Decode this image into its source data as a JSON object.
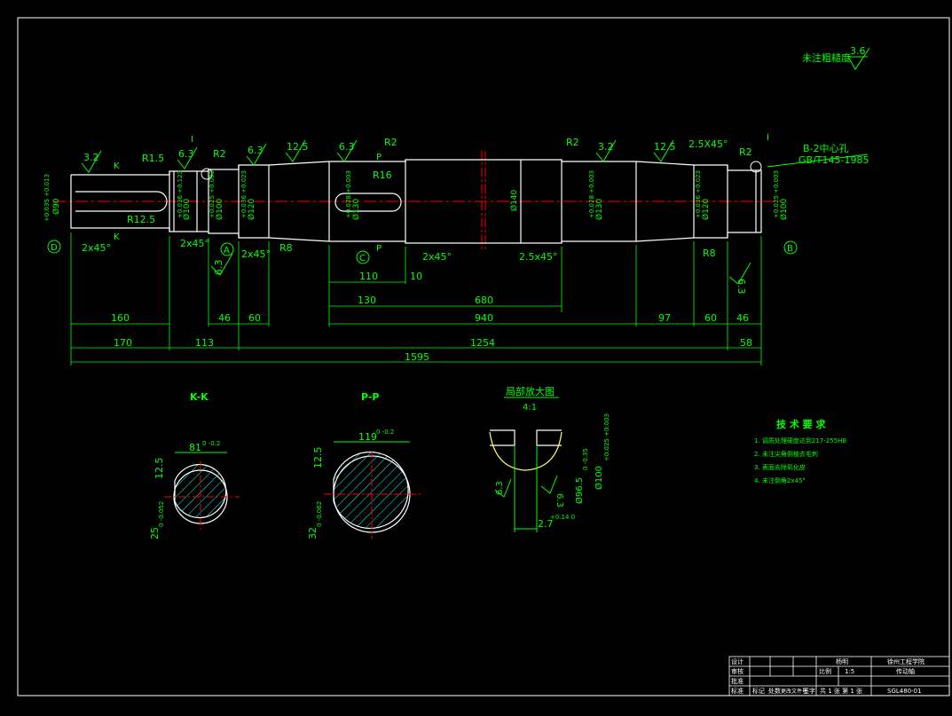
{
  "colors": {
    "background": "#000000",
    "outline": "#ffffff",
    "dimension": "#00ff00",
    "centerline": "#ff0000",
    "hatch": "#00ffff",
    "groove": "#ffff66",
    "note": "#00ff00"
  },
  "roughness_note": {
    "label": "未注粗糙度",
    "value": "3.6"
  },
  "center_hole": {
    "line1": "B-2中心孔",
    "line2": "GB/T145-1985"
  },
  "labels": {
    "datum_d": "D",
    "datum_a": "A",
    "datum_c": "C",
    "datum_b": "B",
    "section_k_top": "K",
    "section_k_bottom": "K",
    "section_p_top": "P",
    "section_p_bottom": "P",
    "detail_i_left": "I",
    "detail_i_right": "I"
  },
  "roughness_marks": [
    {
      "id": "r1",
      "value": "3.2"
    },
    {
      "id": "r2",
      "value": "6.3"
    },
    {
      "id": "r3",
      "value": "6.3"
    },
    {
      "id": "r4",
      "value": "12.5"
    },
    {
      "id": "r5",
      "value": "6.3"
    },
    {
      "id": "r6",
      "value": "3.2"
    },
    {
      "id": "r7",
      "value": "12.5"
    },
    {
      "id": "r8",
      "value": "6.3"
    },
    {
      "id": "r9",
      "value": "6.3"
    }
  ],
  "radii": {
    "r15": "R1.5",
    "r2a": "R2",
    "r2b": "R2",
    "r2c": "R2",
    "r2d": "R2",
    "r125": "R12.5",
    "r16": "R16",
    "r8a": "R8",
    "r8b": "R8"
  },
  "chamfers": {
    "c1": "2x45°",
    "c2": "2x45°",
    "c3": "2x45°",
    "c4": "2x45°",
    "c5": "2.5x45°",
    "c6": "2.5X45°"
  },
  "diameters": {
    "d90": "Ø90",
    "d90_tol": "+0.035 +0.013",
    "d100a": "Ø100",
    "d100a_tol": "+0.036 +0.123",
    "d100b": "Ø100",
    "d100b_tol": "+0.025 +0.003",
    "d120a": "Ø120",
    "d120a_tol": "+0.036 +0.023",
    "d130a": "Ø130",
    "d130a_tol": "+0.028 +0.003",
    "d140": "Ø140",
    "d130b": "Ø130",
    "d130b_tol": "+0.028 +0.003",
    "d120b": "Ø120",
    "d120b_tol": "+0.036 +0.023",
    "d100c": "Ø100",
    "d100c_tol": "+0.025 +0.003"
  },
  "dims": {
    "d160": "160",
    "d46a": "46",
    "d60a": "60",
    "d110": "110",
    "d10": "10",
    "d130": "130",
    "d680": "680",
    "d940": "940",
    "d97": "97",
    "d60b": "60",
    "d46b": "46",
    "d170": "170",
    "d113": "113",
    "d1254": "1254",
    "d58": "58",
    "d1595": "1595"
  },
  "section_k": {
    "title": "K-K",
    "width": "81",
    "width_tol": "0 -0.2",
    "key": "25",
    "key_tol": "0 -0.052",
    "rough": "12.5"
  },
  "section_p": {
    "title": "P-P",
    "width": "119",
    "width_tol": "0 -0.2",
    "key": "32",
    "key_tol": "0 -0.062",
    "rough": "12.5"
  },
  "detail": {
    "title": "局部放大图",
    "scale": "4:1",
    "d96": "Ø96.5",
    "d96_tol": "0 -0.35",
    "d100": "Ø100",
    "d100_tol": "+0.025 +0.003",
    "groove": "2.7",
    "groove_tol": "+0.14 0",
    "rough1": "6.3",
    "rough2": "6.3"
  },
  "tech": {
    "title": "技 术 要 求",
    "items": [
      "1. 调质处理硬度达到217-255HB",
      "2. 未注尖角倒棱去毛刺",
      "3. 表面去除氧化皮",
      "4. 未注倒角2x45°"
    ]
  },
  "title_block": {
    "designer": "设计",
    "checker": "审核",
    "approver": "批准",
    "standard": "标准",
    "name_col": "杨明",
    "scale_label": "比例",
    "scale_value": "1:5",
    "sheet": "共 1 张  第 1 张",
    "school": "徐州工程学院",
    "part": "传动轴",
    "code": "SGL480-01",
    "marker": "标记",
    "count": "处数",
    "file": "更改文件号",
    "sign": "签字"
  }
}
